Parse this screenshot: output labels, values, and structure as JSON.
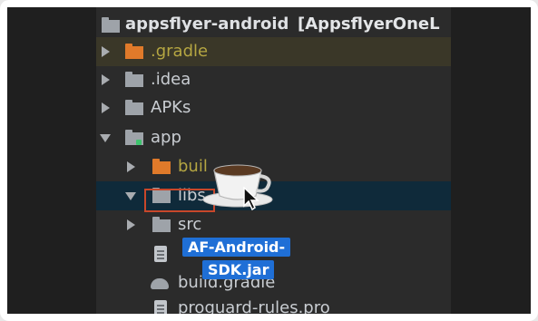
{
  "project": {
    "name": "appsflyer-android",
    "module_bracket": "[AppsflyerOneL"
  },
  "tree": {
    "gradle": ".gradle",
    "idea": ".idea",
    "apks": "APKs",
    "app": "app",
    "build_partial": "buil",
    "libs_partial": "libs",
    "src": "src",
    "build_gradle_partial": "build.gradle",
    "proguard": "proguard-rules.pro"
  },
  "drag": {
    "tooltip_line1": "AF-Android-",
    "tooltip_line2": "SDK.jar"
  },
  "colors": {
    "panel_bg": "#2b2b2b",
    "folder_orange": "#e07a2a",
    "folder_gray": "#9ea3a9",
    "selection_border": "#c8472a",
    "tooltip_bg": "#1f6fd6"
  },
  "icons": {
    "project": "project-folder-icon",
    "folder": "folder-icon",
    "excluded_folder": "excluded-folder-icon",
    "module": "module-folder-icon",
    "file": "file-icon",
    "gradle": "gradle-icon",
    "drag_item": "coffee-cup-icon",
    "cursor": "mouse-cursor-icon"
  }
}
